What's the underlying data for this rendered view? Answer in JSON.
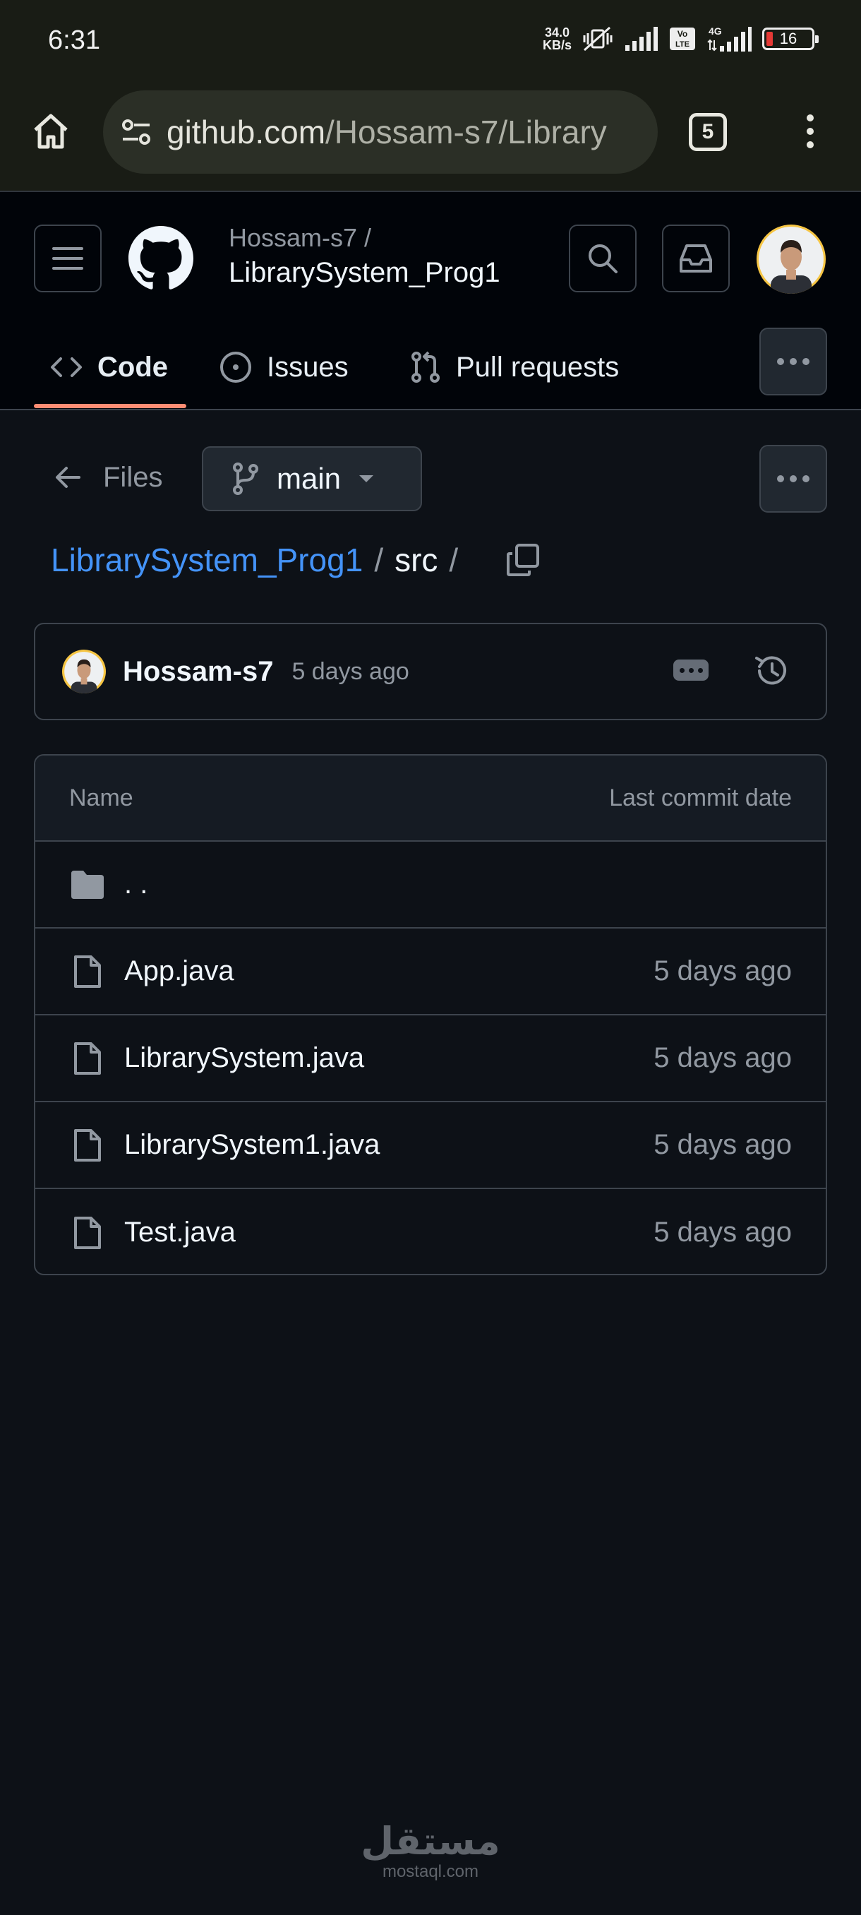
{
  "status_bar": {
    "time": "6:31",
    "net_speed_value": "34.0",
    "net_speed_unit": "KB/s",
    "volte": "Vo LTE",
    "network": "4G",
    "battery": "16"
  },
  "browser": {
    "url_domain": "github.com",
    "url_path": "/Hossam-s7/Library",
    "tab_count": "5"
  },
  "repo": {
    "owner": "Hossam-s7 /",
    "name": "LibrarySystem_Prog1"
  },
  "nav": {
    "code": "Code",
    "issues": "Issues",
    "pull_requests": "Pull requests"
  },
  "file_nav": {
    "back_label": "Files",
    "branch": "main"
  },
  "breadcrumb": {
    "repo": "LibrarySystem_Prog1",
    "separator": "/",
    "dir": "src",
    "trailing": "/"
  },
  "commit": {
    "author": "Hossam-s7",
    "time": "5 days ago"
  },
  "table": {
    "col_name": "Name",
    "col_date": "Last commit date",
    "parent_dir": ". .",
    "files": [
      {
        "name": "App.java",
        "date": "5 days ago"
      },
      {
        "name": "LibrarySystem.java",
        "date": "5 days ago"
      },
      {
        "name": "LibrarySystem1.java",
        "date": "5 days ago"
      },
      {
        "name": "Test.java",
        "date": "5 days ago"
      }
    ]
  },
  "watermark": {
    "arabic": "مستقل",
    "latin": "mostaql.com"
  },
  "colors": {
    "background": "#0d1117",
    "link": "#4493f8",
    "nav_underline": "#fd8c73",
    "browser_chrome": "#191c15"
  }
}
